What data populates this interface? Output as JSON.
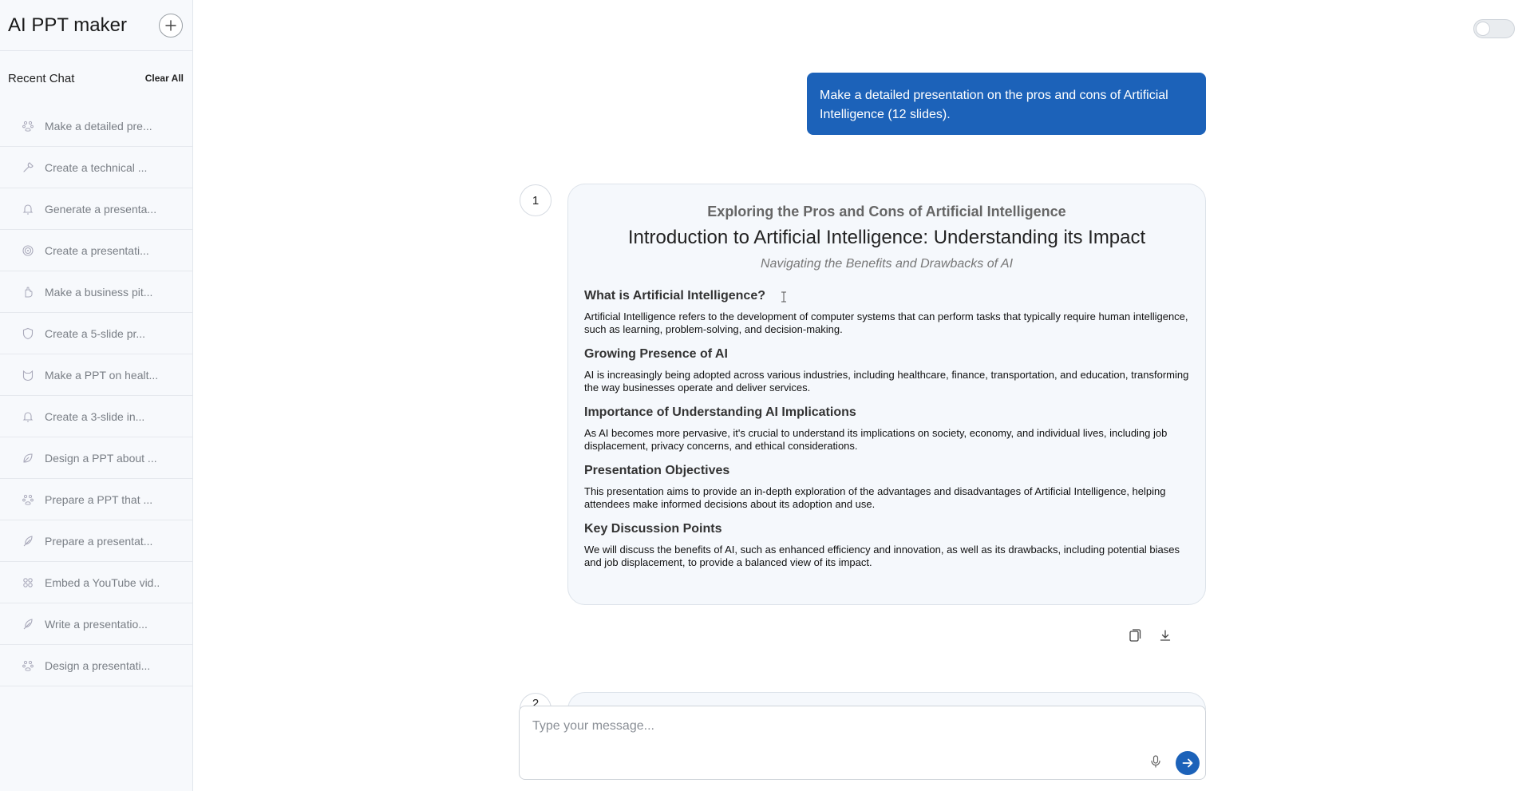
{
  "app": {
    "title": "AI PPT maker"
  },
  "sidebar": {
    "recent_label": "Recent Chat",
    "clear_all_label": "Clear All",
    "items": [
      {
        "label": "Make a detailed pre...",
        "icon": "paw-icon"
      },
      {
        "label": "Create a technical ...",
        "icon": "wrench-icon"
      },
      {
        "label": "Generate a presenta...",
        "icon": "bell-icon"
      },
      {
        "label": "Create a presentati...",
        "icon": "spiral-icon"
      },
      {
        "label": "Make a business pit...",
        "icon": "hand-icon"
      },
      {
        "label": "Create a 5-slide pr...",
        "icon": "shield-icon"
      },
      {
        "label": "Make a PPT on healt...",
        "icon": "cat-icon"
      },
      {
        "label": "Create a 3-slide in...",
        "icon": "bell-icon"
      },
      {
        "label": "Design a PPT about ...",
        "icon": "leaf-icon"
      },
      {
        "label": "Prepare a PPT that ...",
        "icon": "paw-icon"
      },
      {
        "label": "Prepare a presentat...",
        "icon": "feather-icon"
      },
      {
        "label": "Embed a YouTube vid..",
        "icon": "grid-icon"
      },
      {
        "label": "Write a presentatio...",
        "icon": "feather-icon"
      },
      {
        "label": "Design a presentati...",
        "icon": "paw-icon"
      }
    ]
  },
  "conversation": {
    "user_message": "Make a detailed presentation on the pros and cons of Artificial Intelligence (12 slides).",
    "slide": {
      "number": "1",
      "kicker": "Exploring the Pros and Cons of Artificial Intelligence",
      "title": "Introduction to Artificial Intelligence: Understanding its Impact",
      "subtitle": "Navigating the Benefits and Drawbacks of AI",
      "sections": [
        {
          "heading": "What is Artificial Intelligence?",
          "body": "Artificial Intelligence refers to the development of computer systems that can perform tasks that typically require human intelligence, such as learning, problem-solving, and decision-making."
        },
        {
          "heading": "Growing Presence of AI",
          "body": "AI is increasingly being adopted across various industries, including healthcare, finance, transportation, and education, transforming the way businesses operate and deliver services."
        },
        {
          "heading": "Importance of Understanding AI Implications",
          "body": "As AI becomes more pervasive, it's crucial to understand its implications on society, economy, and individual lives, including job displacement, privacy concerns, and ethical considerations."
        },
        {
          "heading": "Presentation Objectives",
          "body": "This presentation aims to provide an in-depth exploration of the advantages and disadvantages of Artificial Intelligence, helping attendees make informed decisions about its adoption and use."
        },
        {
          "heading": "Key Discussion Points",
          "body": "We will discuss the benefits of AI, such as enhanced efficiency and innovation, as well as its drawbacks, including potential biases and job displacement, to provide a balanced view of its impact."
        }
      ]
    },
    "next_slide_number": "2"
  },
  "composer": {
    "placeholder": "Type your message..."
  },
  "colors": {
    "accent": "#1c62b9",
    "sidebar_bg": "#f7f9fc",
    "slide_bg": "#f5f8fc"
  }
}
